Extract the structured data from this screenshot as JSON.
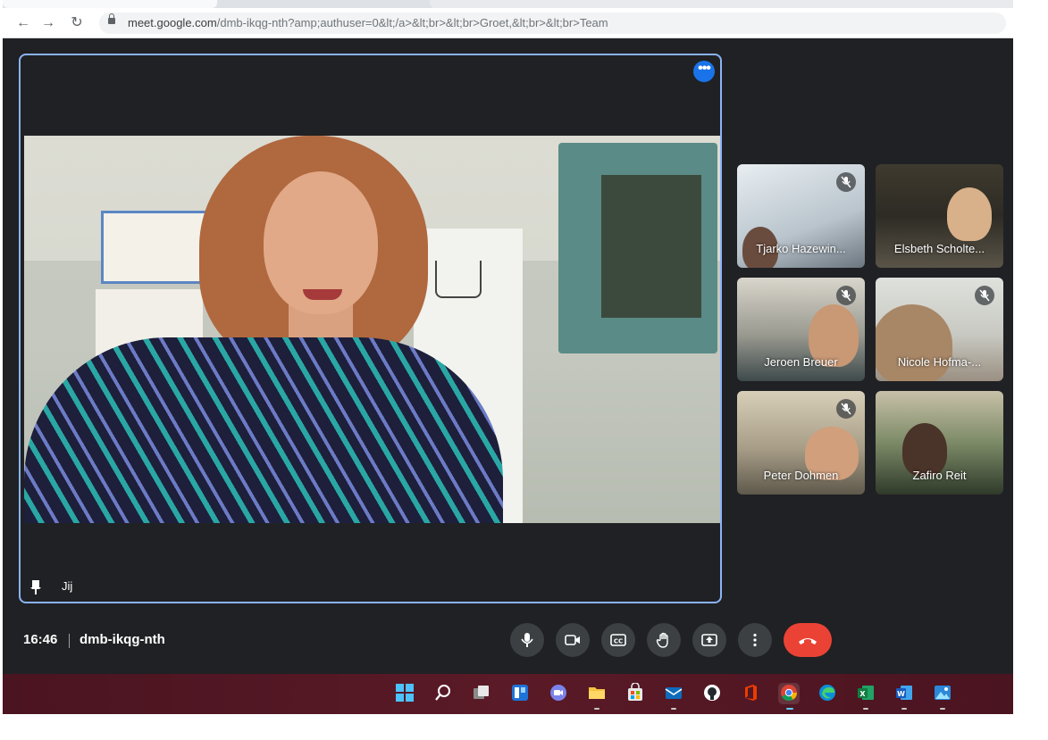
{
  "browser": {
    "url_host": "meet.google.com",
    "url_rest": "/dmb-ikqg-nth?amp;authuser=0&lt;/a>&lt;br>&lt;br>Groet,&lt;br>&lt;br>Team"
  },
  "main_tile": {
    "name": "Jij"
  },
  "participants": [
    {
      "name": "Tjarko Hazewin...",
      "muted": true
    },
    {
      "name": "Elsbeth Scholte...",
      "muted": false
    },
    {
      "name": "Jeroen Breuer",
      "muted": true
    },
    {
      "name": "Nicole Hofma-...",
      "muted": true
    },
    {
      "name": "Peter Dohmen",
      "muted": true
    },
    {
      "name": "Zafiro Reit",
      "muted": false
    }
  ],
  "bottom_bar": {
    "time": "16:46",
    "meeting_code": "dmb-ikqg-nth"
  },
  "colors": {
    "background": "#202124",
    "accent": "#8ab4f8",
    "end_call": "#ea4335",
    "control": "#3c4043",
    "taskbar": "#4a1420"
  },
  "taskbar_icons": [
    "windows-start-icon",
    "search-icon",
    "task-view-icon",
    "widgets-icon",
    "teams-chat-icon",
    "file-explorer-icon",
    "store-icon",
    "mail-icon",
    "github-icon",
    "office-icon",
    "chrome-icon",
    "edge-icon",
    "excel-icon",
    "word-icon",
    "photos-icon"
  ]
}
